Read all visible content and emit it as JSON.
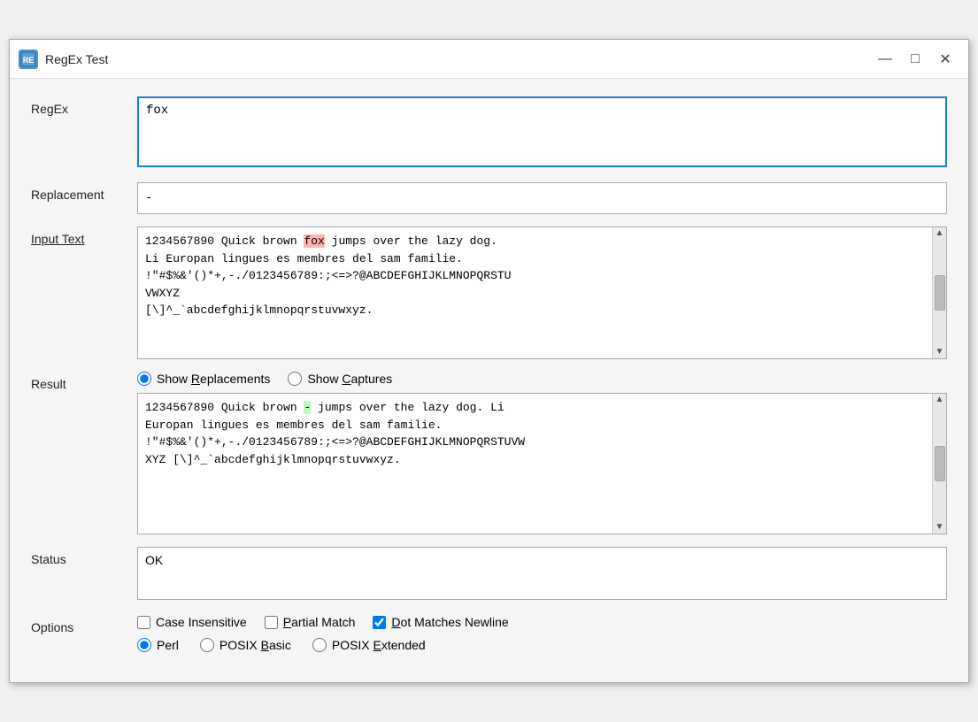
{
  "window": {
    "title": "RegEx Test",
    "icon_label": "RE"
  },
  "titlebar": {
    "minimize_label": "—",
    "maximize_label": "□",
    "close_label": "✕"
  },
  "labels": {
    "regex": "RegEx",
    "replacement": "Replacement",
    "input_text": "Input Text",
    "result": "Result",
    "status": "Status",
    "options": "Options"
  },
  "regex_value": "fox",
  "replacement_value": "-",
  "input_text": "1234567890 Quick brown fox jumps over the lazy dog.\nLi Europan lingues es membres del sam familie.\n!\"#$%&'()*+,-./0123456789:;<=>?@ABCDEFGHIJKLMNOPQRSTU\nVWXYZ\n[\\]^_`abcdefghijklmnopqrstuvwxyz.",
  "result_options": {
    "show_replacements": "Show Replacements",
    "show_captures": "Show Captures"
  },
  "result_text": "1234567890 Quick brown - jumps over the lazy dog. Li\nEuropan lingues es membres del sam familie.\n!\"#$%&'()*+,-./0123456789:;<=>?@ABCDEFGHIJKLMNOPQRSTUVW\nXYZ [\\]^_`abcdefghijklmnopqrstuvwxyz.",
  "status_text": "OK",
  "options": {
    "case_insensitive": "Case Insensitive",
    "partial_match": "Partial Match",
    "dot_matches_newline": "Dot Matches Newline",
    "perl": "Perl",
    "posix_basic": "POSIX Basic",
    "posix_extended": "POSIX Extended"
  }
}
